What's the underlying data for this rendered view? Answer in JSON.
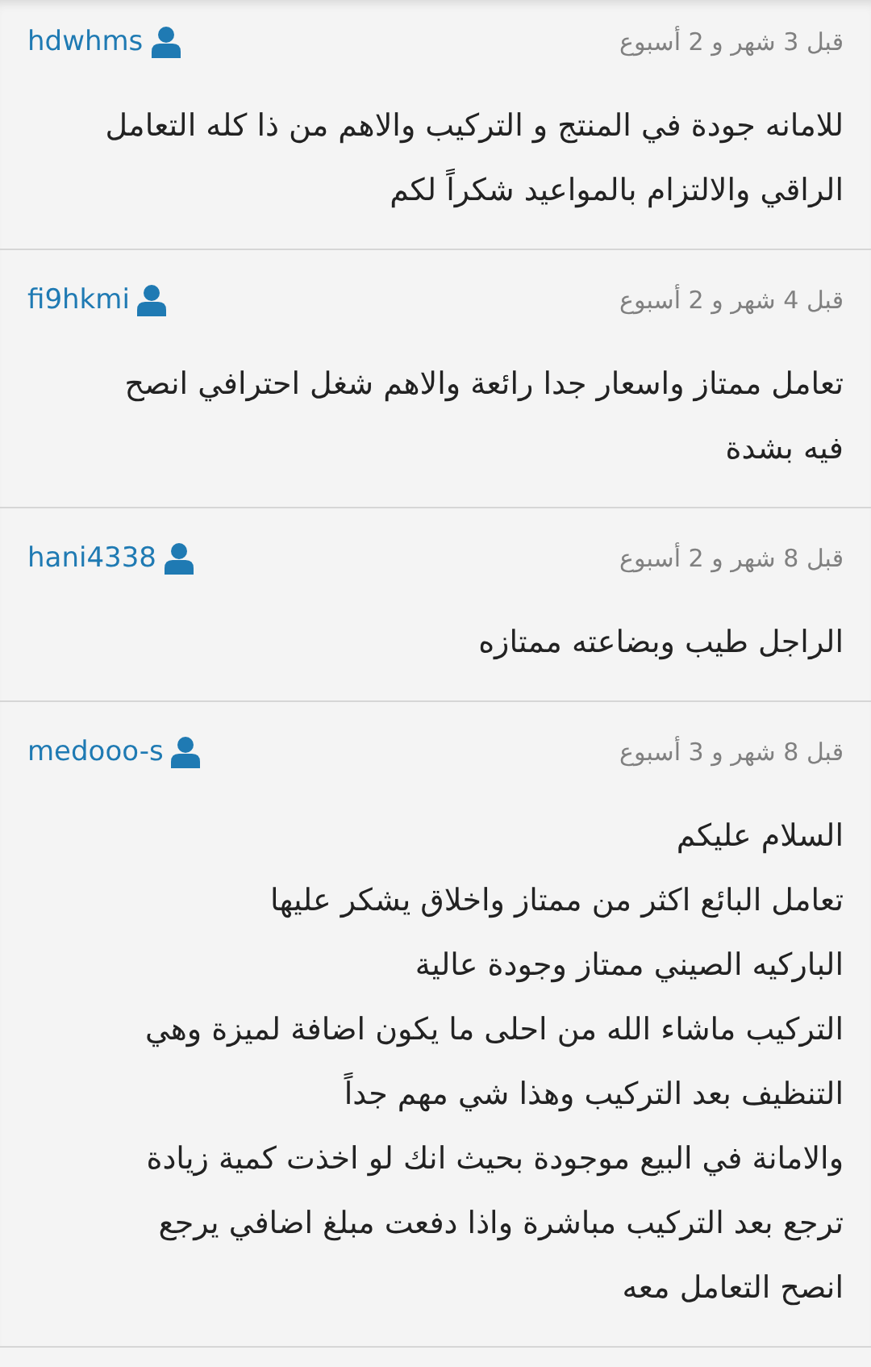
{
  "comments": [
    {
      "user": "hdwhms",
      "time": "قبل 3 شهر و 2 أسبوع",
      "paragraphs": [
        "للامانه جودة في المنتج و التركيب والاهم من ذا كله التعامل\nالراقي والالتزام بالمواعيد شكراً لكم"
      ]
    },
    {
      "user": "fi9hkmi",
      "time": "قبل 4 شهر و 2 أسبوع",
      "paragraphs": [
        "تعامل ممتاز واسعار جدا رائعة والاهم شغل احترافي انصح\nفيه بشدة"
      ]
    },
    {
      "user": "hani4338",
      "time": "قبل 8 شهر و 2 أسبوع",
      "paragraphs": [
        "الراجل طيب وبضاعته ممتازه"
      ]
    },
    {
      "user": "medooo-s",
      "time": "قبل 8 شهر و 3 أسبوع",
      "paragraphs": [
        "السلام عليكم",
        "تعامل البائع اكثر من ممتاز واخلاق يشكر عليها",
        "الباركيه الصيني ممتاز وجودة عالية",
        "التركيب ماشاء الله من احلى ما يكون اضافة لميزة وهي",
        "التنظيف بعد التركيب وهذا شي مهم جداً",
        "والامانة في البيع موجودة بحيث انك لو اخذت كمية زيادة",
        "ترجع بعد التركيب مباشرة واذا دفعت مبلغ اضافي يرجع",
        "انصح التعامل معه"
      ]
    }
  ]
}
